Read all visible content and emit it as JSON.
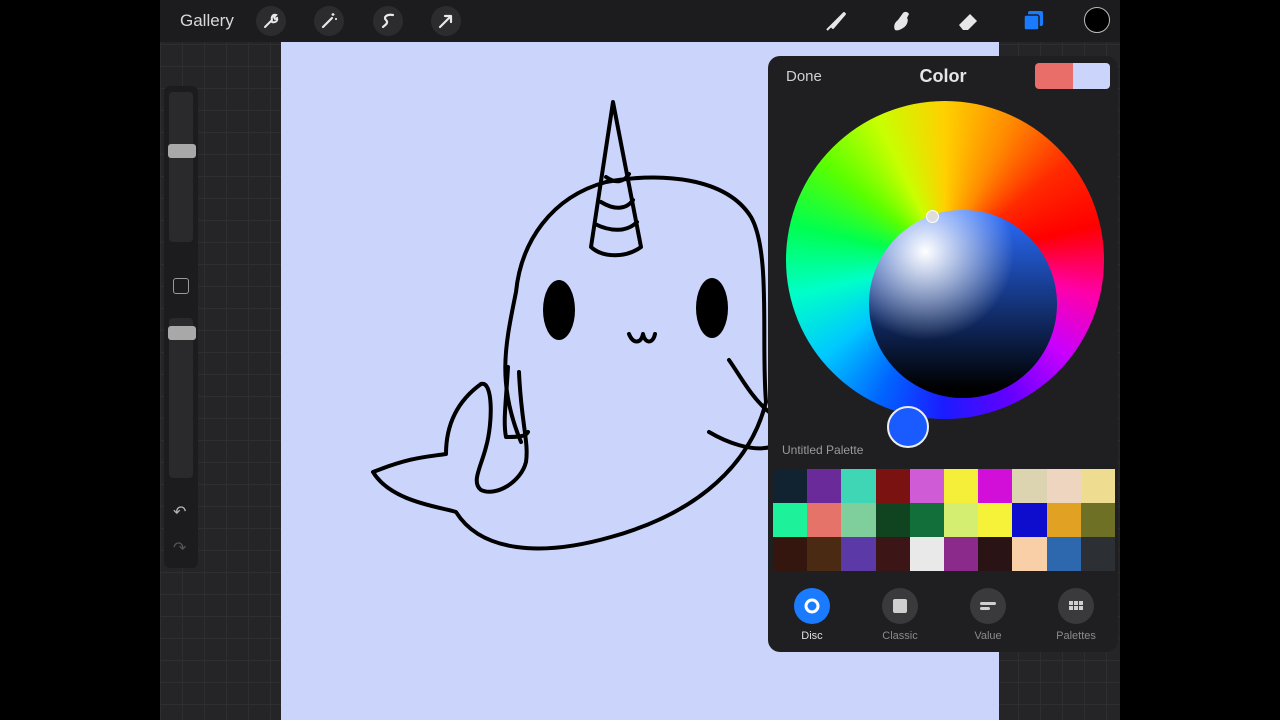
{
  "toolbar": {
    "gallery_label": "Gallery",
    "left_tools": [
      "wrench-icon",
      "magic-wand-icon",
      "selection-icon",
      "transform-arrow-icon"
    ],
    "right_tools": [
      "brush-icon",
      "smudge-icon",
      "eraser-icon",
      "layers-icon",
      "color-swatch"
    ],
    "current_color": "#000000",
    "accent": "#1a7bff"
  },
  "canvas": {
    "background_color": "#cbd5fb",
    "subject": "narwhal-doodle"
  },
  "color_panel": {
    "done_label": "Done",
    "title": "Color",
    "current_color": "#e96e6a",
    "previous_color": "#cbd5fb",
    "wheel_selected_color": "#1a5bff",
    "palette_name": "Untitled Palette",
    "palette_swatches": [
      "#112330",
      "#6a2a9a",
      "#3fd6b5",
      "#7a1212",
      "#cf5cd6",
      "#f5ef3a",
      "#d20fd8",
      "#dcd4b0",
      "#edd5c0",
      "#eedc90",
      "#1df29a",
      "#e5736a",
      "#7fcf9d",
      "#10431f",
      "#136f3a",
      "#d3ee70",
      "#f6f23a",
      "#0e0dce",
      "#e1a123",
      "#6e7026",
      "#35160f",
      "#4b2a14",
      "#5b3aa8",
      "#3c1617",
      "#e9e9e9",
      "#8b2a8a",
      "#2a1314",
      "#f8cfa6",
      "#2d67ad",
      "#2c3035"
    ],
    "tabs": [
      {
        "label": "Disc",
        "icon": "disc-icon",
        "active": true
      },
      {
        "label": "Classic",
        "icon": "classic-square-icon",
        "active": false
      },
      {
        "label": "Value",
        "icon": "value-sliders-icon",
        "active": false
      },
      {
        "label": "Palettes",
        "icon": "palettes-grid-icon",
        "active": false
      }
    ]
  }
}
